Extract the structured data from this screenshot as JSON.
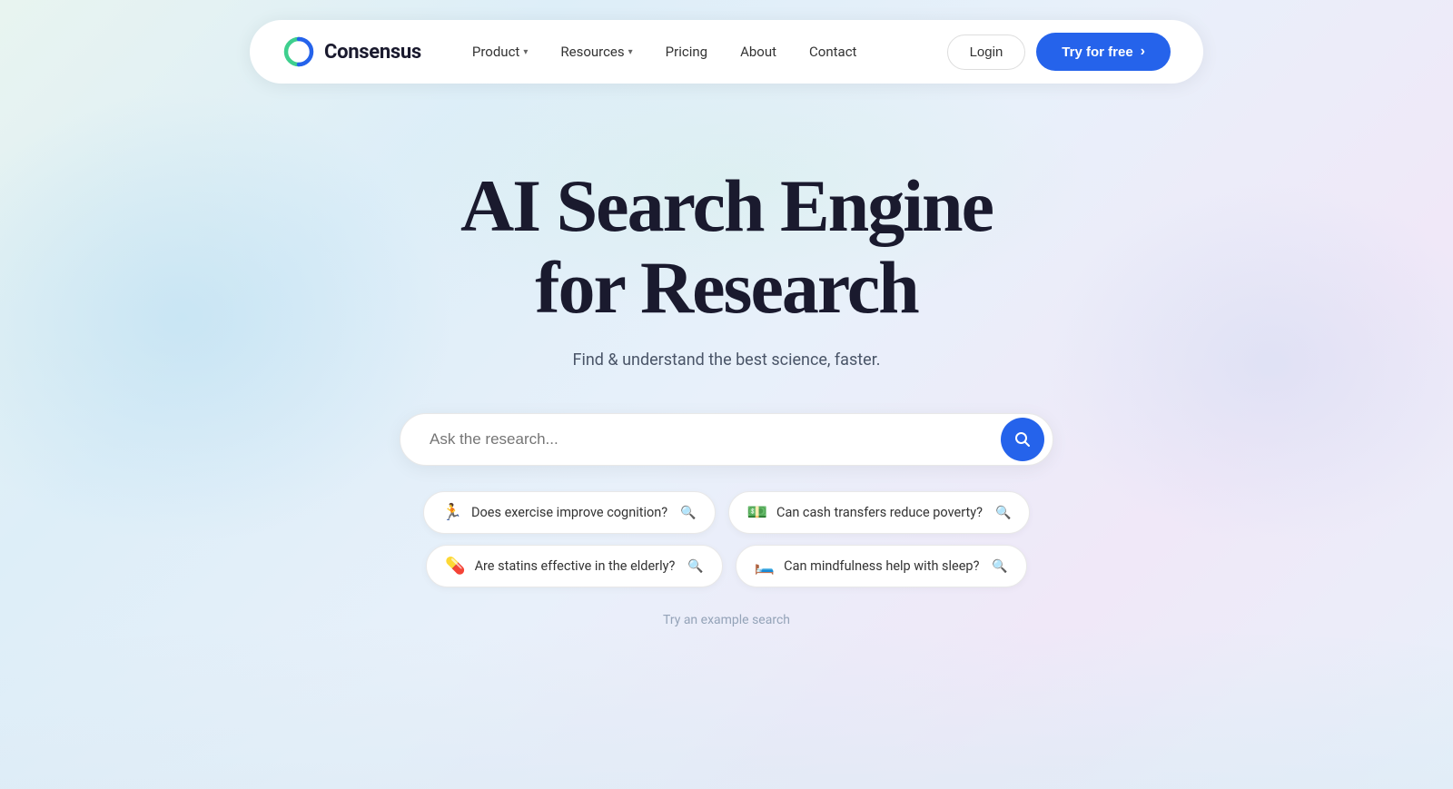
{
  "page": {
    "title": "Consensus - AI Search Engine for Research"
  },
  "navbar": {
    "logo_text": "Consensus",
    "nav_items": [
      {
        "label": "Product",
        "has_dropdown": true
      },
      {
        "label": "Resources",
        "has_dropdown": true
      },
      {
        "label": "Pricing",
        "has_dropdown": false
      },
      {
        "label": "About",
        "has_dropdown": false
      },
      {
        "label": "Contact",
        "has_dropdown": false
      }
    ],
    "login_label": "Login",
    "try_label": "Try for free"
  },
  "hero": {
    "title_line1": "AI Search Engine",
    "title_line2": "for Research",
    "subtitle": "Find & understand the best science, faster."
  },
  "search": {
    "placeholder": "Ask the research..."
  },
  "example_chips": {
    "row1": [
      {
        "emoji": "🏃",
        "text": "Does exercise improve cognition?"
      },
      {
        "emoji": "💵",
        "text": "Can cash transfers reduce poverty?"
      }
    ],
    "row2": [
      {
        "emoji": "💊",
        "text": "Are statins effective in the elderly?"
      },
      {
        "emoji": "🛏️",
        "text": "Can mindfulness help with sleep?"
      }
    ],
    "try_label": "Try an example search"
  }
}
